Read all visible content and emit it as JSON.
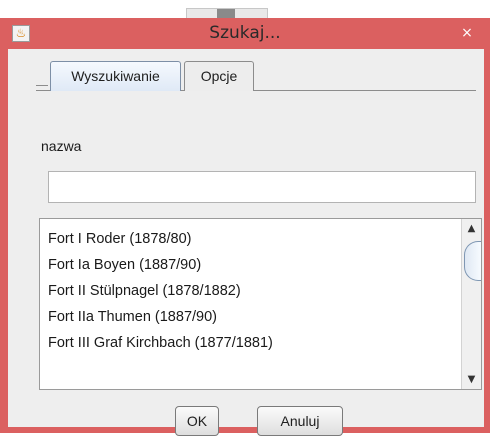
{
  "window": {
    "title": "Szukaj...",
    "app_icon": "java-cup-icon",
    "close_icon": "close-icon",
    "close_glyph": "×",
    "accent_color": "#db6060"
  },
  "tabs": [
    {
      "label": "Wyszukiwanie",
      "active": true
    },
    {
      "label": "Opcje",
      "active": false
    }
  ],
  "search": {
    "label": "nazwa",
    "value": ""
  },
  "results": {
    "items": [
      "Fort I Roder (1878/80)",
      "Fort Ia Boyen (1887/90)",
      "Fort II Stülpnagel (1878/1882)",
      "Fort IIa Thumen (1887/90)",
      "Fort III Graf Kirchbach (1877/1881)"
    ]
  },
  "buttons": {
    "ok_label": "OK",
    "cancel_label": "Anuluj"
  }
}
